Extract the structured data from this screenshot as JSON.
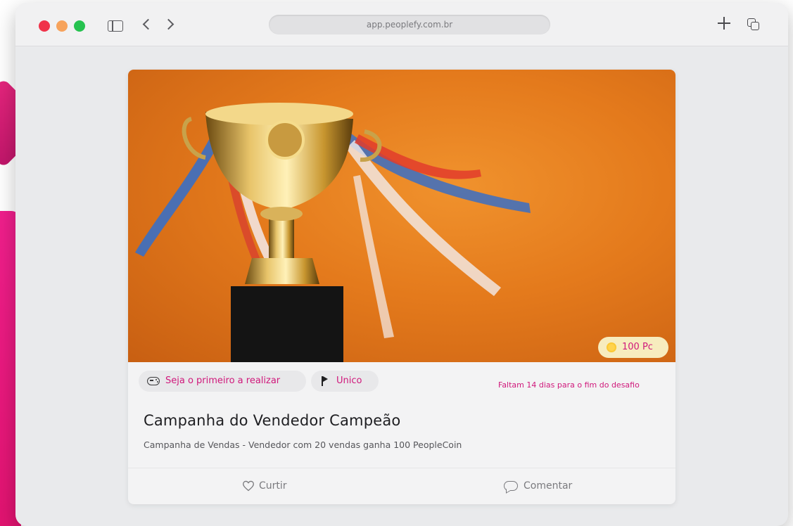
{
  "browser": {
    "url": "app.peoplefy.com.br"
  },
  "card": {
    "reward": "100 Pc",
    "chips": {
      "first": "Seja o primeiro a realizar",
      "type": "Unico"
    },
    "deadline": "Faltam 14 dias para o fim do desafio",
    "title": "Campanha do Vendedor Campeão",
    "description": "Campanha de Vendas - Vendedor com 20 vendas ganha 100 PeopleCoin",
    "actions": {
      "like": "Curtir",
      "comment": "Comentar"
    }
  },
  "colors": {
    "accent": "#d0187b",
    "hero_background": "#e47a1c",
    "badge_background": "#f7ecbe"
  },
  "icons": [
    "sidebar-icon",
    "back-icon",
    "forward-icon",
    "plus-icon",
    "tabs-icon",
    "coin-icon",
    "gamepad-icon",
    "flag-icon",
    "heart-icon",
    "comment-icon"
  ]
}
